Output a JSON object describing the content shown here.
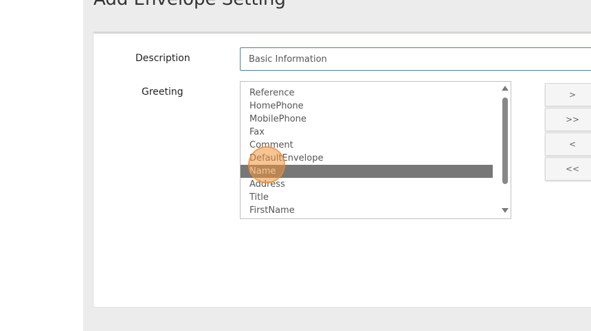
{
  "page": {
    "title": "Add Envelope Setting"
  },
  "form": {
    "description_label": "Description",
    "description_value": "Basic Information",
    "greeting_label": "Greeting"
  },
  "greeting_list": {
    "items": [
      "Reference",
      "HomePhone",
      "MobilePhone",
      "Fax",
      "Comment",
      "DefaultEnvelope",
      "Name",
      "Address",
      "Title",
      "FirstName"
    ],
    "selected": "Name"
  },
  "move_buttons": {
    "add": ">",
    "add_all": ">>",
    "remove": "<",
    "remove_all": "<<"
  },
  "colors": {
    "selected_row": "#777777",
    "input_border": "#4a7fa0",
    "click_indicator": "#f0963c"
  }
}
